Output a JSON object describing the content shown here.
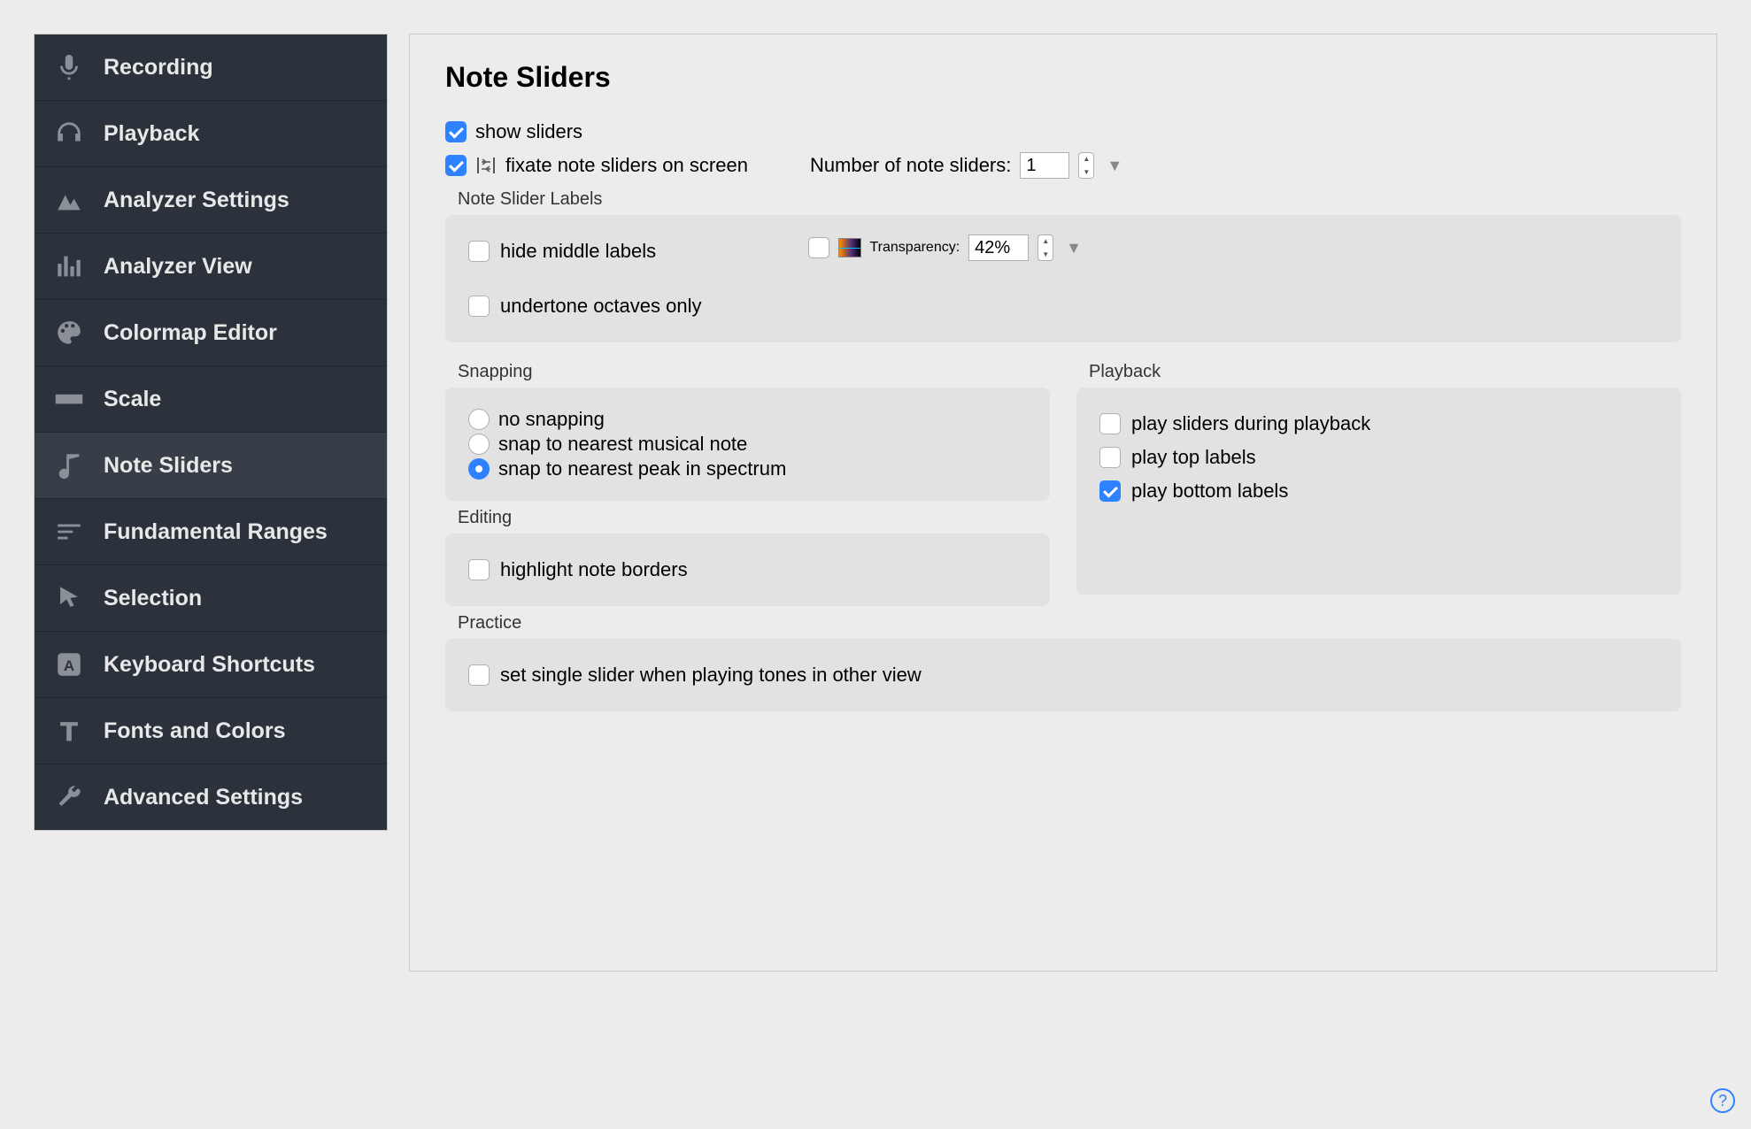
{
  "sidebar": {
    "items": [
      {
        "label": "Recording",
        "icon": "mic-icon"
      },
      {
        "label": "Playback",
        "icon": "headphones-icon"
      },
      {
        "label": "Analyzer Settings",
        "icon": "mountains-icon"
      },
      {
        "label": "Analyzer View",
        "icon": "bars-icon"
      },
      {
        "label": "Colormap Editor",
        "icon": "palette-icon"
      },
      {
        "label": "Scale",
        "icon": "ruler-icon"
      },
      {
        "label": "Note Sliders",
        "icon": "note-icon"
      },
      {
        "label": "Fundamental Ranges",
        "icon": "lines-icon"
      },
      {
        "label": "Selection",
        "icon": "cursor-icon"
      },
      {
        "label": "Keyboard Shortcuts",
        "icon": "key-a-icon"
      },
      {
        "label": "Fonts and Colors",
        "icon": "type-t-icon"
      },
      {
        "label": "Advanced Settings",
        "icon": "wrench-icon"
      }
    ],
    "active_index": 6
  },
  "main": {
    "title": "Note Sliders",
    "show_sliders": {
      "label": "show sliders",
      "checked": true
    },
    "fixate": {
      "label": "fixate note sliders on screen",
      "checked": true
    },
    "number_label": "Number of note sliders:",
    "number_value": "1",
    "labels_group": {
      "title": "Note Slider Labels",
      "hide_middle": {
        "label": "hide middle labels",
        "checked": false
      },
      "undertone": {
        "label": "undertone octaves only",
        "checked": false
      },
      "transparency_enable": {
        "checked": false
      },
      "transparency_label": "Transparency:",
      "transparency_value": "42%"
    },
    "snapping": {
      "title": "Snapping",
      "options": [
        {
          "label": "no snapping",
          "checked": false
        },
        {
          "label": "snap to nearest musical note",
          "checked": false
        },
        {
          "label": "snap to nearest peak in spectrum",
          "checked": true
        }
      ]
    },
    "playback": {
      "title": "Playback",
      "play_during": {
        "label": "play sliders during playback",
        "checked": false
      },
      "play_top": {
        "label": "play top labels",
        "checked": false
      },
      "play_bottom": {
        "label": "play bottom labels",
        "checked": true
      }
    },
    "editing": {
      "title": "Editing",
      "highlight": {
        "label": "highlight note borders",
        "checked": false
      }
    },
    "practice": {
      "title": "Practice",
      "single": {
        "label": "set single slider when playing tones in other view",
        "checked": false
      }
    },
    "help": "?"
  }
}
